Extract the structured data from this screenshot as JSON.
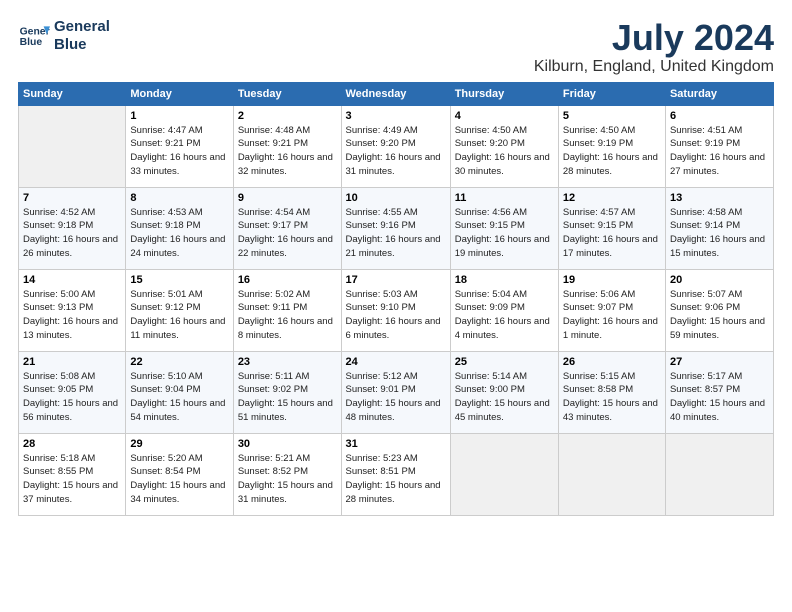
{
  "header": {
    "logo_line1": "General",
    "logo_line2": "Blue",
    "month": "July 2024",
    "location": "Kilburn, England, United Kingdom"
  },
  "weekdays": [
    "Sunday",
    "Monday",
    "Tuesday",
    "Wednesday",
    "Thursday",
    "Friday",
    "Saturday"
  ],
  "weeks": [
    [
      {
        "day": "",
        "empty": true
      },
      {
        "day": "1",
        "sunrise": "4:47 AM",
        "sunset": "9:21 PM",
        "daylight": "16 hours and 33 minutes."
      },
      {
        "day": "2",
        "sunrise": "4:48 AM",
        "sunset": "9:21 PM",
        "daylight": "16 hours and 32 minutes."
      },
      {
        "day": "3",
        "sunrise": "4:49 AM",
        "sunset": "9:20 PM",
        "daylight": "16 hours and 31 minutes."
      },
      {
        "day": "4",
        "sunrise": "4:50 AM",
        "sunset": "9:20 PM",
        "daylight": "16 hours and 30 minutes."
      },
      {
        "day": "5",
        "sunrise": "4:50 AM",
        "sunset": "9:19 PM",
        "daylight": "16 hours and 28 minutes."
      },
      {
        "day": "6",
        "sunrise": "4:51 AM",
        "sunset": "9:19 PM",
        "daylight": "16 hours and 27 minutes."
      }
    ],
    [
      {
        "day": "7",
        "sunrise": "4:52 AM",
        "sunset": "9:18 PM",
        "daylight": "16 hours and 26 minutes."
      },
      {
        "day": "8",
        "sunrise": "4:53 AM",
        "sunset": "9:18 PM",
        "daylight": "16 hours and 24 minutes."
      },
      {
        "day": "9",
        "sunrise": "4:54 AM",
        "sunset": "9:17 PM",
        "daylight": "16 hours and 22 minutes."
      },
      {
        "day": "10",
        "sunrise": "4:55 AM",
        "sunset": "9:16 PM",
        "daylight": "16 hours and 21 minutes."
      },
      {
        "day": "11",
        "sunrise": "4:56 AM",
        "sunset": "9:15 PM",
        "daylight": "16 hours and 19 minutes."
      },
      {
        "day": "12",
        "sunrise": "4:57 AM",
        "sunset": "9:15 PM",
        "daylight": "16 hours and 17 minutes."
      },
      {
        "day": "13",
        "sunrise": "4:58 AM",
        "sunset": "9:14 PM",
        "daylight": "16 hours and 15 minutes."
      }
    ],
    [
      {
        "day": "14",
        "sunrise": "5:00 AM",
        "sunset": "9:13 PM",
        "daylight": "16 hours and 13 minutes."
      },
      {
        "day": "15",
        "sunrise": "5:01 AM",
        "sunset": "9:12 PM",
        "daylight": "16 hours and 11 minutes."
      },
      {
        "day": "16",
        "sunrise": "5:02 AM",
        "sunset": "9:11 PM",
        "daylight": "16 hours and 8 minutes."
      },
      {
        "day": "17",
        "sunrise": "5:03 AM",
        "sunset": "9:10 PM",
        "daylight": "16 hours and 6 minutes."
      },
      {
        "day": "18",
        "sunrise": "5:04 AM",
        "sunset": "9:09 PM",
        "daylight": "16 hours and 4 minutes."
      },
      {
        "day": "19",
        "sunrise": "5:06 AM",
        "sunset": "9:07 PM",
        "daylight": "16 hours and 1 minute."
      },
      {
        "day": "20",
        "sunrise": "5:07 AM",
        "sunset": "9:06 PM",
        "daylight": "15 hours and 59 minutes."
      }
    ],
    [
      {
        "day": "21",
        "sunrise": "5:08 AM",
        "sunset": "9:05 PM",
        "daylight": "15 hours and 56 minutes."
      },
      {
        "day": "22",
        "sunrise": "5:10 AM",
        "sunset": "9:04 PM",
        "daylight": "15 hours and 54 minutes."
      },
      {
        "day": "23",
        "sunrise": "5:11 AM",
        "sunset": "9:02 PM",
        "daylight": "15 hours and 51 minutes."
      },
      {
        "day": "24",
        "sunrise": "5:12 AM",
        "sunset": "9:01 PM",
        "daylight": "15 hours and 48 minutes."
      },
      {
        "day": "25",
        "sunrise": "5:14 AM",
        "sunset": "9:00 PM",
        "daylight": "15 hours and 45 minutes."
      },
      {
        "day": "26",
        "sunrise": "5:15 AM",
        "sunset": "8:58 PM",
        "daylight": "15 hours and 43 minutes."
      },
      {
        "day": "27",
        "sunrise": "5:17 AM",
        "sunset": "8:57 PM",
        "daylight": "15 hours and 40 minutes."
      }
    ],
    [
      {
        "day": "28",
        "sunrise": "5:18 AM",
        "sunset": "8:55 PM",
        "daylight": "15 hours and 37 minutes."
      },
      {
        "day": "29",
        "sunrise": "5:20 AM",
        "sunset": "8:54 PM",
        "daylight": "15 hours and 34 minutes."
      },
      {
        "day": "30",
        "sunrise": "5:21 AM",
        "sunset": "8:52 PM",
        "daylight": "15 hours and 31 minutes."
      },
      {
        "day": "31",
        "sunrise": "5:23 AM",
        "sunset": "8:51 PM",
        "daylight": "15 hours and 28 minutes."
      },
      {
        "day": "",
        "empty": true
      },
      {
        "day": "",
        "empty": true
      },
      {
        "day": "",
        "empty": true
      }
    ]
  ]
}
